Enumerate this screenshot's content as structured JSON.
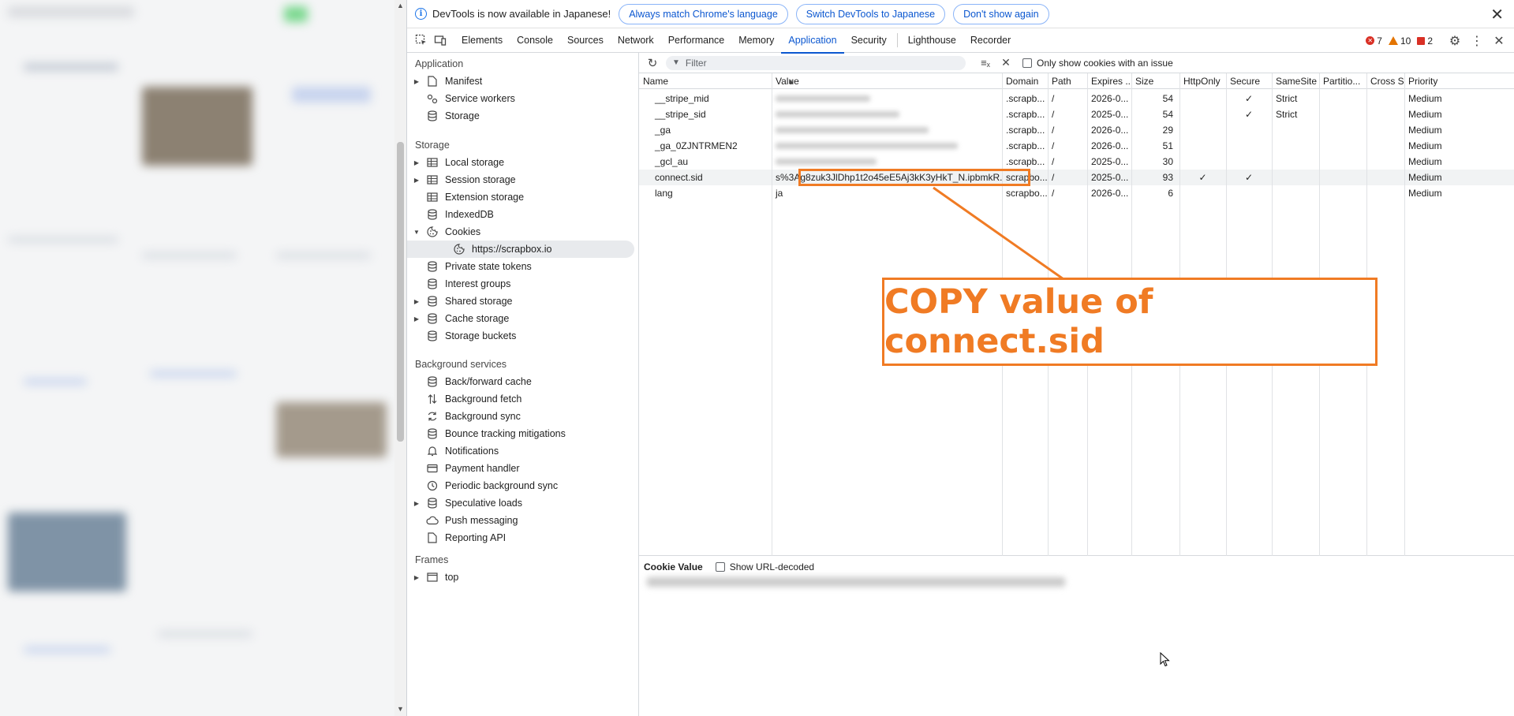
{
  "infobar": {
    "message": "DevTools is now available in Japanese!",
    "buttons": [
      "Always match Chrome's language",
      "Switch DevTools to Japanese",
      "Don't show again"
    ]
  },
  "tabs": [
    "Elements",
    "Console",
    "Sources",
    "Network",
    "Performance",
    "Memory",
    "Application",
    "Security",
    "Lighthouse",
    "Recorder"
  ],
  "active_tab": "Application",
  "counters": {
    "errors": "7",
    "warnings": "10",
    "issues": "2"
  },
  "sidebar": {
    "application": {
      "title": "Application",
      "items": [
        {
          "label": "Manifest",
          "icon": "file-icon",
          "expandable": true
        },
        {
          "label": "Service workers",
          "icon": "gears-icon",
          "expandable": false
        },
        {
          "label": "Storage",
          "icon": "database-icon",
          "expandable": false
        }
      ]
    },
    "storage": {
      "title": "Storage",
      "items": [
        {
          "label": "Local storage",
          "icon": "table-icon",
          "expandable": true
        },
        {
          "label": "Session storage",
          "icon": "table-icon",
          "expandable": true
        },
        {
          "label": "Extension storage",
          "icon": "table-icon",
          "expandable": false
        },
        {
          "label": "IndexedDB",
          "icon": "database-icon",
          "expandable": false
        },
        {
          "label": "Cookies",
          "icon": "cookie-icon",
          "expandable": true,
          "expanded": true
        },
        {
          "label": "https://scrapbox.io",
          "icon": "cookie-icon",
          "child": true,
          "selected": true
        },
        {
          "label": "Private state tokens",
          "icon": "database-icon",
          "expandable": false
        },
        {
          "label": "Interest groups",
          "icon": "database-icon",
          "expandable": false
        },
        {
          "label": "Shared storage",
          "icon": "database-icon",
          "expandable": true
        },
        {
          "label": "Cache storage",
          "icon": "database-icon",
          "expandable": true
        },
        {
          "label": "Storage buckets",
          "icon": "database-icon",
          "expandable": false
        }
      ]
    },
    "background": {
      "title": "Background services",
      "items": [
        {
          "label": "Back/forward cache",
          "icon": "database-icon"
        },
        {
          "label": "Background fetch",
          "icon": "updown-arrow-icon"
        },
        {
          "label": "Background sync",
          "icon": "sync-icon"
        },
        {
          "label": "Bounce tracking mitigations",
          "icon": "database-icon"
        },
        {
          "label": "Notifications",
          "icon": "bell-icon"
        },
        {
          "label": "Payment handler",
          "icon": "card-icon"
        },
        {
          "label": "Periodic background sync",
          "icon": "clock-icon"
        },
        {
          "label": "Speculative loads",
          "icon": "database-icon",
          "expandable": true
        },
        {
          "label": "Push messaging",
          "icon": "cloud-icon"
        },
        {
          "label": "Reporting API",
          "icon": "file-icon"
        }
      ]
    },
    "frames": {
      "title": "Frames",
      "items": [
        {
          "label": "top",
          "icon": "frame-icon",
          "expandable": true
        }
      ]
    }
  },
  "toolbar": {
    "filter_placeholder": "Filter",
    "only_issue_label": "Only show cookies with an issue"
  },
  "table": {
    "columns": [
      "Name",
      "Value",
      "Domain",
      "Path",
      "Expires ...",
      "Size",
      "HttpOnly",
      "Secure",
      "SameSite",
      "Partitio...",
      "Cross Si...",
      "Priority"
    ],
    "rows": [
      {
        "name": "__stripe_mid",
        "value": "",
        "domain": ".scrapb...",
        "path": "/",
        "expires": "2026-0...",
        "size": "54",
        "httponly": "",
        "secure": "✓",
        "samesite": "Strict",
        "priority": "Medium",
        "value_blurred": true
      },
      {
        "name": "__stripe_sid",
        "value": "",
        "domain": ".scrapb...",
        "path": "/",
        "expires": "2025-0...",
        "size": "54",
        "httponly": "",
        "secure": "✓",
        "samesite": "Strict",
        "priority": "Medium",
        "value_blurred": true
      },
      {
        "name": "_ga",
        "value": "",
        "domain": ".scrapb...",
        "path": "/",
        "expires": "2026-0...",
        "size": "29",
        "httponly": "",
        "secure": "",
        "samesite": "",
        "priority": "Medium",
        "value_blurred": true
      },
      {
        "name": "_ga_0ZJNTRMEN2",
        "value": "",
        "domain": ".scrapb...",
        "path": "/",
        "expires": "2026-0...",
        "size": "51",
        "httponly": "",
        "secure": "",
        "samesite": "",
        "priority": "Medium",
        "value_blurred": true
      },
      {
        "name": "_gcl_au",
        "value": "",
        "domain": ".scrapb...",
        "path": "/",
        "expires": "2025-0...",
        "size": "30",
        "httponly": "",
        "secure": "",
        "samesite": "",
        "priority": "Medium",
        "value_blurred": true
      },
      {
        "name": "connect.sid",
        "value": "s%3Ag8zuk3JlDhp1t2o45eE5Aj3kK3yHkT_N.ipbmkR...",
        "domain": "scrapbo...",
        "path": "/",
        "expires": "2025-0...",
        "size": "93",
        "httponly": "✓",
        "secure": "✓",
        "samesite": "",
        "priority": "Medium",
        "selected": true
      },
      {
        "name": "lang",
        "value": "ja",
        "domain": "scrapbo...",
        "path": "/",
        "expires": "2026-0...",
        "size": "6",
        "httponly": "",
        "secure": "",
        "samesite": "",
        "priority": "Medium"
      }
    ]
  },
  "annotation": {
    "text": "COPY value of connect.sid",
    "color": "#f07b24"
  },
  "cookie_value": {
    "title": "Cookie Value",
    "decode_label": "Show URL-decoded"
  }
}
